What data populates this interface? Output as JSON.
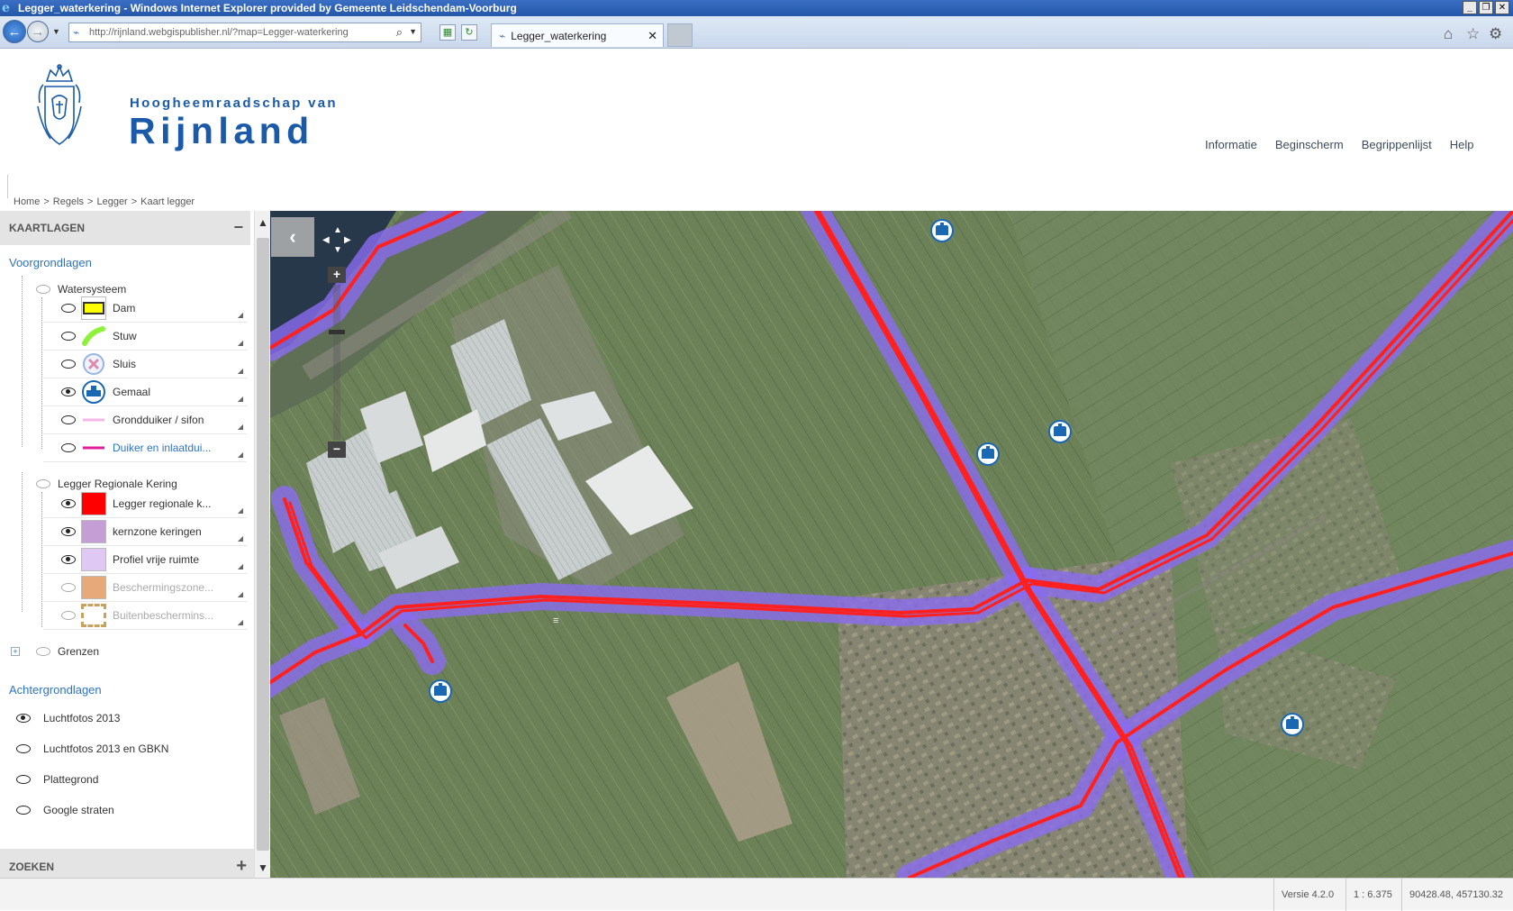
{
  "window": {
    "title": "Legger_waterkering - Windows Internet Explorer provided by Gemeente Leidschendam-Voorburg",
    "controls": [
      "_",
      "❐",
      "✕"
    ]
  },
  "browser": {
    "url": "http://rijnland.webgispublisher.nl/?map=Legger-waterkering",
    "tab_title": "Legger_waterkering",
    "tab_close": "✕"
  },
  "site": {
    "brand_top": "Hoogheemraadschap van",
    "brand_main": "Rijnland",
    "nav": [
      "Informatie",
      "Beginscherm",
      "Begrippenlijst",
      "Help"
    ],
    "breadcrumb": [
      "Home",
      "Regels",
      "Legger",
      "Kaart legger"
    ],
    "breadcrumb_sep": ">"
  },
  "panel": {
    "header": "KAARTLAGEN",
    "collapse": "−",
    "foreground_title": "Voorgrondlagen",
    "groups": {
      "watersysteem": "Watersysteem",
      "kering": "Legger Regionale Kering",
      "grenzen": "Grenzen"
    },
    "water_layers": [
      {
        "label": "Dam",
        "visible": false,
        "icon": "dam-swatch"
      },
      {
        "label": "Stuw",
        "visible": false,
        "icon": "stuw-swatch"
      },
      {
        "label": "Sluis",
        "visible": false,
        "icon": "sluis-swatch"
      },
      {
        "label": "Gemaal",
        "visible": true,
        "icon": "gemaal-swatch"
      },
      {
        "label": "Grondduiker / sifon",
        "visible": false,
        "icon": "grondduiker-swatch"
      },
      {
        "label": "Duiker en inlaatdui...",
        "visible": false,
        "icon": "duiker-swatch"
      }
    ],
    "kering_layers": [
      {
        "label": "Legger regionale k...",
        "visible": true,
        "color": "#ff0000"
      },
      {
        "label": "kernzone keringen",
        "visible": true,
        "color": "#c59ed6"
      },
      {
        "label": "Profiel vrije ruimte",
        "visible": true,
        "color": "#e0c8f5"
      },
      {
        "label": "Beschermingszone...",
        "visible": false,
        "color": "#e8a97a"
      },
      {
        "label": "Buitenbeschermins...",
        "visible": false,
        "color": "#c8a060"
      }
    ],
    "background_title": "Achtergrondlagen",
    "background_layers": [
      {
        "label": "Luchtfotos 2013",
        "selected": true
      },
      {
        "label": "Luchtfotos 2013 en GBKN",
        "selected": false
      },
      {
        "label": "Plattegrond",
        "selected": false
      },
      {
        "label": "Google straten",
        "selected": false
      }
    ],
    "search_header": "ZOEKEN",
    "search_expand": "+",
    "expand_symbol": "+"
  },
  "map": {
    "toggle_symbol": "‹",
    "zoom_in": "+",
    "zoom_out": "−",
    "colors": {
      "kering_line": "#ff2020",
      "kernzone": "#8a6cf0"
    }
  },
  "status": {
    "version": "Versie 4.2.0",
    "scale": "1 : 6.375",
    "coords": "90428.48, 457130.32"
  }
}
